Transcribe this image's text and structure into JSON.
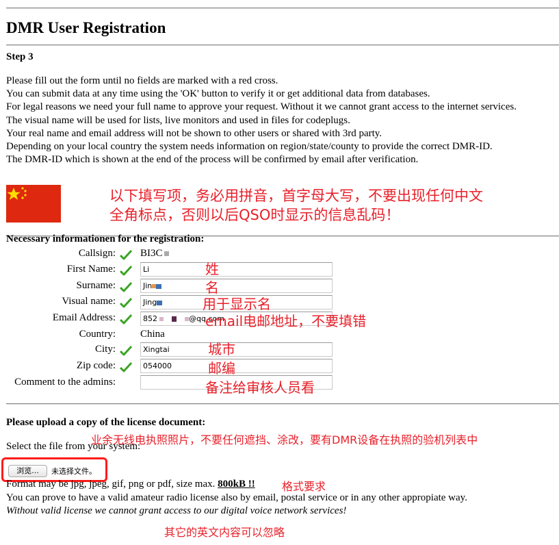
{
  "page": {
    "title": "DMR User Registration",
    "step": "Step 3"
  },
  "intro": [
    "Please fill out the form until no fields are marked with a red cross.",
    "You can submit data at any time using the 'OK' button to verify it or get additional data from databases.",
    "For legal reasons we need your full name to approve your request. Without it we cannot grant access to the internet services.",
    "The visual name will be used for lists, live monitors and used in files for codeplugs.",
    "Your real name and email address will not be shown to other users or shared with 3rd party.",
    "Depending on your local country the system needs information on region/state/county to provide the correct DMR-ID.",
    "The DMR-ID which is shown at the end of the process will be confirmed by email after verification."
  ],
  "annotations": {
    "instruction_line1": "以下填写项，务必用拼音，首字母大写，不要出现任何中文",
    "instruction_line2": "全角标点，否则以后QSO时显示的信息乱码！",
    "first_name": "姓",
    "surname": "名",
    "visual_name": "用于显示名",
    "email": "email电邮地址，不要填错",
    "city": "城市",
    "zip": "邮编",
    "comment": "备注给审核人员看",
    "upload_note": "业余无线电执照照片，不要任何遮挡、涂改，要有DMR设备在执照的验机列表中",
    "format_note": "格式要求",
    "ignore_note": "其它的英文内容可以忽略"
  },
  "form": {
    "section_title": "Necessary informationen for the registration:",
    "fields": {
      "callsign": {
        "label": "Callsign:",
        "value": "BI3C"
      },
      "first_name": {
        "label": "First Name:",
        "value": "Li"
      },
      "surname": {
        "label": "Surname:",
        "value": "Jin"
      },
      "visual_name": {
        "label": "Visual name:",
        "value": "Jing"
      },
      "email": {
        "label": "Email Address:",
        "value_prefix": "852",
        "value_suffix": "@qq.com"
      },
      "country": {
        "label": "Country:",
        "value": "China"
      },
      "city": {
        "label": "City:",
        "value": "Xingtai"
      },
      "zip": {
        "label": "Zip code:",
        "value": "054000"
      },
      "comment": {
        "label": "Comment to the admins:",
        "value": ""
      }
    }
  },
  "upload": {
    "section_title": "Please upload a copy of the license document:",
    "select_prompt": "Select the file from your system:",
    "browse_label": "浏览...",
    "file_status": "未选择文件。",
    "format_text": "Format may be jpg, jpeg, gif, png or pdf, size max.",
    "max_size": "800kB !!",
    "alt_proof": "You can prove to have a valid amateur radio license also by email, postal service or in any other appropiate way.",
    "warning": "Without valid license we cannot grant access to our digital voice network services!"
  },
  "colors": {
    "annotation_red": "#e8202a",
    "flag_red": "#de2910",
    "flag_star": "#ffde00",
    "check_green": "#3aa424"
  }
}
